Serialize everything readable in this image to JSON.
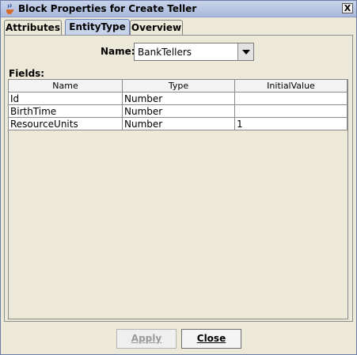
{
  "window": {
    "title": "Block Properties for Create Teller",
    "close_label": "X"
  },
  "tabs": [
    {
      "label": "Attributes"
    },
    {
      "label": "EntityType"
    },
    {
      "label": "Overview"
    }
  ],
  "form": {
    "name_label": "Name:",
    "name_value": "BankTellers",
    "fields_label": "Fields:"
  },
  "table": {
    "headers": [
      "Name",
      "Type",
      "InitialValue"
    ],
    "rows": [
      {
        "name": "Id",
        "type": "Number",
        "initial": ""
      },
      {
        "name": "BirthTime",
        "type": "Number",
        "initial": ""
      },
      {
        "name": "ResourceUnits",
        "type": "Number",
        "initial": "1"
      }
    ]
  },
  "buttons": {
    "apply": "Apply",
    "close": "Close"
  },
  "icons": {
    "window_icon": "java-cup-icon",
    "dropdown": "chevron-down-icon"
  }
}
